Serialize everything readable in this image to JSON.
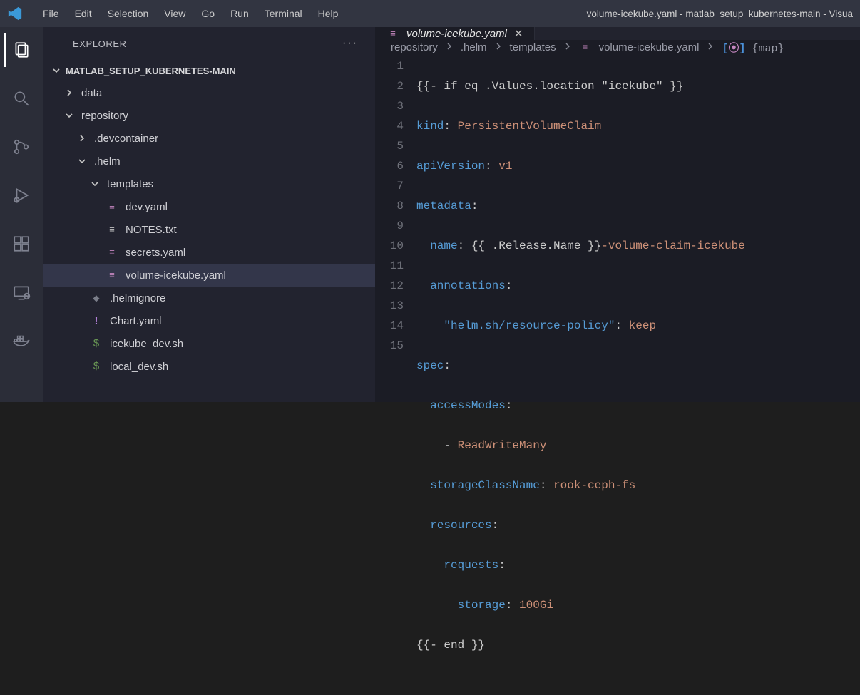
{
  "window_title": "volume-icekube.yaml - matlab_setup_kubernetes-main - Visua",
  "menu": [
    "File",
    "Edit",
    "Selection",
    "View",
    "Go",
    "Run",
    "Terminal",
    "Help"
  ],
  "sidebar": {
    "title": "EXPLORER",
    "project": "MATLAB_SETUP_KUBERNETES-MAIN",
    "tree": {
      "data": "data",
      "repository": "repository",
      "devcontainer": ".devcontainer",
      "helm": ".helm",
      "templates": "templates",
      "dev": "dev.yaml",
      "notes": "NOTES.txt",
      "secrets": "secrets.yaml",
      "volume": "volume-icekube.yaml",
      "helmignore": ".helmignore",
      "chart": "Chart.yaml",
      "icekube_dev": "icekube_dev.sh",
      "local_dev": "local_dev.sh"
    }
  },
  "tab": {
    "label": "volume-icekube.yaml",
    "close": "✕"
  },
  "breadcrumb": {
    "p0": "repository",
    "p1": ".helm",
    "p2": "templates",
    "p3": "volume-icekube.yaml",
    "p4": "{map}"
  },
  "code": {
    "line_numbers": [
      "1",
      "2",
      "3",
      "4",
      "5",
      "6",
      "7",
      "8",
      "9",
      "10",
      "11",
      "12",
      "13",
      "14",
      "15"
    ],
    "l1": {
      "a": "{{- if eq .Values.location \"icekube\" }}"
    },
    "l2": {
      "k": "kind",
      "v": "PersistentVolumeClaim"
    },
    "l3": {
      "k": "apiVersion",
      "v": "v1"
    },
    "l4": {
      "k": "metadata"
    },
    "l5": {
      "k": "name",
      "t": "{{ .Release.Name }}",
      "v": "-volume-claim-icekube"
    },
    "l6": {
      "k": "annotations"
    },
    "l7": {
      "k": "\"helm.sh/resource-policy\"",
      "v": "keep"
    },
    "l8": {
      "k": "spec"
    },
    "l9": {
      "k": "accessModes"
    },
    "l10": {
      "dash": "- ",
      "v": "ReadWriteMany"
    },
    "l11": {
      "k": "storageClassName",
      "v": "rook-ceph-fs"
    },
    "l12": {
      "k": "resources"
    },
    "l13": {
      "k": "requests"
    },
    "l14": {
      "k": "storage",
      "v": "100Gi"
    },
    "l15": {
      "a": "{{- end }}"
    }
  }
}
